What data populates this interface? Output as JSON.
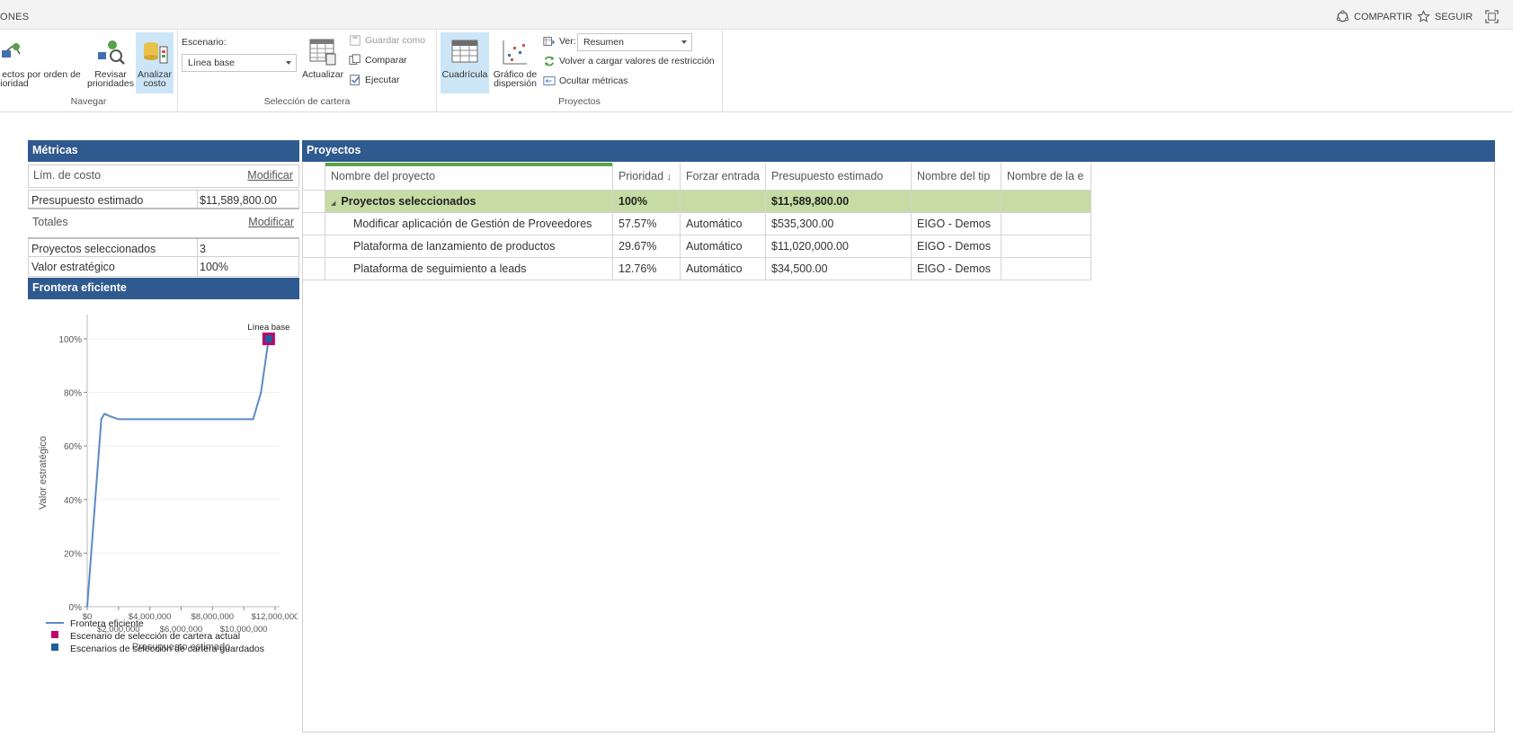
{
  "topbar": {
    "tab_text": "ONES",
    "share_label": "COMPARTIR",
    "follow_label": "SEGUIR"
  },
  "ribbon": {
    "navegar": {
      "label": "Navegar",
      "proj_priority_l1": "ectos por orden de",
      "proj_priority_l2": "ioridad",
      "review_l1": "Revisar",
      "review_l2": "prioridades",
      "analyze_l1": "Analizar",
      "analyze_l2": "costo"
    },
    "seleccion": {
      "label": "Selección de cartera",
      "scenario_label": "Escenario:",
      "scenario_value": "Línea base",
      "update_label": "Actualizar",
      "save_as_label": "Guardar como",
      "compare_label": "Comparar",
      "run_label": "Ejecutar"
    },
    "proyectos": {
      "label": "Proyectos",
      "grid_label": "Cuadrícula",
      "scatter_l1": "Gráfico de",
      "scatter_l2": "dispersión",
      "view_label": "Ver:",
      "view_value": "Resumen",
      "reload_label": "Volver a cargar valores de restricción",
      "hide_label": "Ocultar métricas"
    }
  },
  "metrics": {
    "title": "Métricas",
    "cost_limit_label": "Lím. de costo",
    "modify_label": "Modificar",
    "estimated_budget_label": "Presupuesto estimado",
    "estimated_budget_value": "$11,589,800.00",
    "totals_label": "Totales",
    "selected_projects_label": "Proyectos seleccionados",
    "selected_projects_value": "3",
    "strategic_value_label": "Valor estratégico",
    "strategic_value_value": "100%"
  },
  "frontier": {
    "title": "Frontera eficiente"
  },
  "projects": {
    "title": "Proyectos",
    "columns": [
      "Nombre del proyecto",
      "Prioridad",
      "Forzar entrada",
      "Presupuesto estimado",
      "Nombre del tip",
      "Nombre de la e"
    ],
    "group": {
      "name": "Proyectos seleccionados",
      "priority": "100%",
      "budget": "$11,589,800.00"
    },
    "rows": [
      {
        "name": "Modificar aplicación de Gestión de Proveedores",
        "priority": "57.57%",
        "force": "Automático",
        "budget": "$535,300.00",
        "type": "EIGO - Demos",
        "ent": ""
      },
      {
        "name": "Plataforma de lanzamiento de productos",
        "priority": "29.67%",
        "force": "Automático",
        "budget": "$11,020,000.00",
        "type": "EIGO - Demos",
        "ent": ""
      },
      {
        "name": "Plataforma de seguimiento a leads",
        "priority": "12.76%",
        "force": "Automático",
        "budget": "$34,500.00",
        "type": "EIGO - Demos",
        "ent": ""
      }
    ]
  },
  "chart_data": {
    "type": "line",
    "title": "",
    "xlabel": "Presupuesto estimado",
    "ylabel": "Valor estratégico",
    "xlim": [
      0,
      12000000
    ],
    "ylim": [
      0,
      100
    ],
    "x_ticks": [
      "$0",
      "$2,000,000",
      "$4,000,000",
      "$6,000,000",
      "$8,000,000",
      "$10,000,000",
      "$12,000,000"
    ],
    "y_ticks": [
      "0%",
      "20%",
      "40%",
      "60%",
      "80%",
      "100%"
    ],
    "series": [
      {
        "name": "Frontera eficiente",
        "color": "#5b8ac6",
        "x": [
          0,
          900000,
          1100000,
          1500000,
          2000000,
          4000000,
          6000000,
          8000000,
          10000000,
          10600000,
          11100000,
          11589800
        ],
        "y": [
          0,
          70,
          72,
          71,
          70,
          70,
          70,
          70,
          70,
          70,
          80,
          100
        ]
      },
      {
        "name": "Escenario de selección de cartera actual",
        "color": "#c2006b",
        "x": [
          11589800
        ],
        "y": [
          100
        ]
      },
      {
        "name": "Escenarios de selección de cartera guardados",
        "color": "#1f5f9e",
        "x": [
          11589800
        ],
        "y": [
          100
        ]
      }
    ],
    "annotations": [
      {
        "text": "Línea base",
        "x": 11589800,
        "y": 100
      }
    ]
  }
}
